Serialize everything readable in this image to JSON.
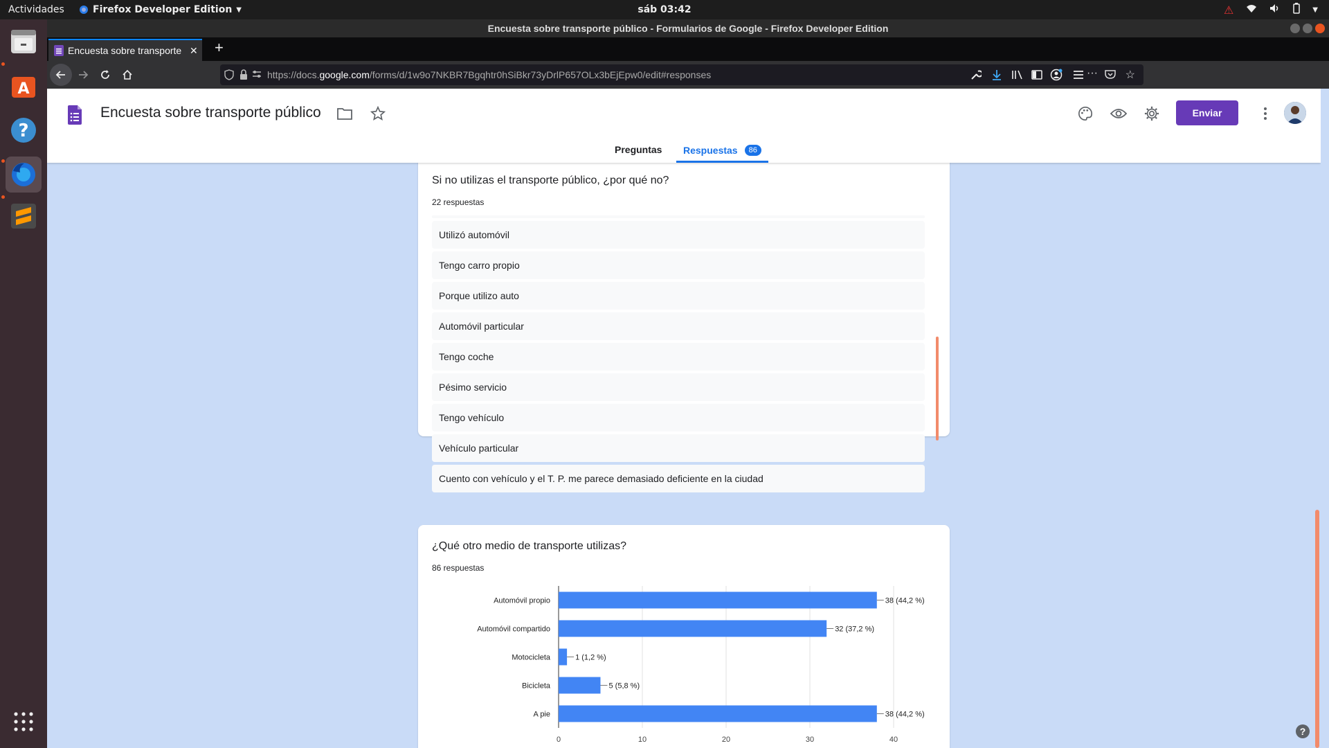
{
  "topbar": {
    "activities": "Actividades",
    "app_name": "Firefox Developer Edition",
    "clock": "sáb 03:42"
  },
  "window": {
    "title": "Encuesta sobre transporte público - Formularios de Google - Firefox Developer Edition"
  },
  "tab": {
    "title": "Encuesta sobre transporte público"
  },
  "url": {
    "prefix": "https://docs.",
    "domain": "google.com",
    "path": "/forms/d/1w9o7NKBR7Bgqhtr0hSiBkr73yDrlP657OLx3bEjEpw0/edit#responses"
  },
  "form": {
    "title": "Encuesta sobre transporte público",
    "send_label": "Enviar",
    "tabs": {
      "questions": "Preguntas",
      "responses": "Respuestas",
      "responses_count": "86"
    }
  },
  "question1": {
    "title": "Si no utilizas el transporte público, ¿por qué no?",
    "count_label": "22 respuestas",
    "responses": [
      "Utilizó automóvil",
      "Tengo carro propio",
      "Porque utilizo auto",
      "Automóvil particular",
      "Tengo coche",
      "Pésimo servicio",
      "Tengo vehículo",
      "Vehículo particular",
      "Cuento con vehículo y el T. P. me parece demasiado deficiente en la ciudad"
    ]
  },
  "question2": {
    "title": "¿Qué otro medio de transporte utilizas?",
    "count_label": "86 respuestas"
  },
  "chart_data": {
    "type": "bar",
    "orientation": "horizontal",
    "categories": [
      "Automóvil propio",
      "Automóvil compartido",
      "Motocicleta",
      "Bicicleta",
      "A pie"
    ],
    "values": [
      38,
      32,
      1,
      5,
      38
    ],
    "data_labels": [
      "38 (44,2 %)",
      "32 (37,2 %)",
      "1 (1,2 %)",
      "5 (5,8 %)",
      "38 (44,2 %)"
    ],
    "xlim": [
      0,
      40
    ],
    "xticks": [
      0,
      10,
      20,
      30,
      40
    ],
    "grid": true,
    "bar_color": "#4285f4"
  },
  "colors": {
    "accent": "#673ab7",
    "link": "#1a73e8",
    "bar": "#4285f4",
    "page_bg": "#c9dbf7"
  }
}
